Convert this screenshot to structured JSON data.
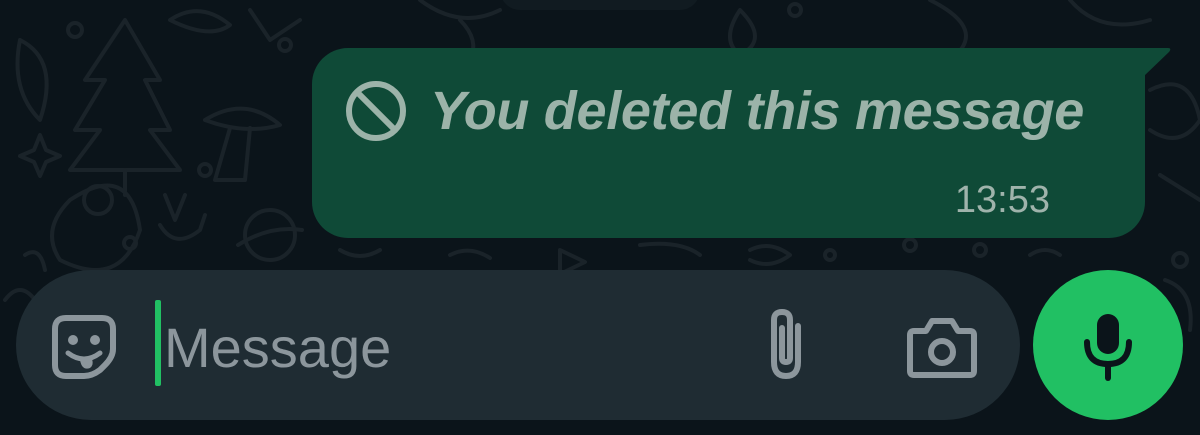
{
  "message": {
    "deleted_text": "You deleted this message",
    "time": "13:53",
    "deleted_icon": "block-icon"
  },
  "composer": {
    "placeholder": "Message",
    "sticker_icon": "sticker-icon",
    "attach_icon": "paperclip-icon",
    "camera_icon": "camera-icon"
  },
  "mic_button": {
    "icon": "mic-icon"
  },
  "colors": {
    "background": "#0b141a",
    "outgoing_bubble": "#0f4a37",
    "deleted_text": "#9cb3a9",
    "composer": "#1f2c33",
    "placeholder": "#8c969c",
    "accent": "#21c063"
  }
}
